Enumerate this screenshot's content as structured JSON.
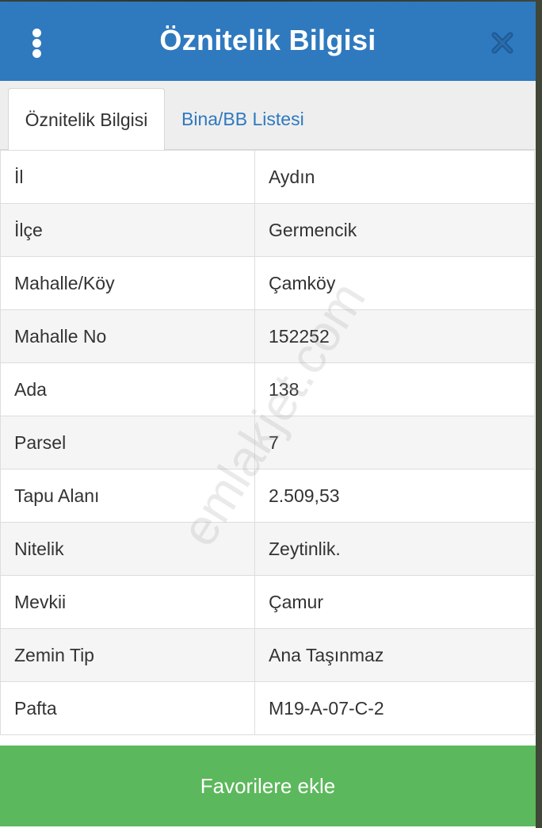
{
  "header": {
    "title": "Öznitelik Bilgisi",
    "menu_icon": "vertical-dots-icon",
    "close_icon": "close-icon",
    "background_color": "#2f79bf"
  },
  "tabs": [
    {
      "label": "Öznitelik Bilgisi",
      "active": true
    },
    {
      "label": "Bina/BB Listesi",
      "active": false
    }
  ],
  "attributes": [
    {
      "key": "İl",
      "value": "Aydın"
    },
    {
      "key": "İlçe",
      "value": "Germencik"
    },
    {
      "key": "Mahalle/Köy",
      "value": "Çamköy"
    },
    {
      "key": "Mahalle No",
      "value": "152252"
    },
    {
      "key": "Ada",
      "value": "138"
    },
    {
      "key": "Parsel",
      "value": "7"
    },
    {
      "key": "Tapu Alanı",
      "value": "2.509,53"
    },
    {
      "key": "Nitelik",
      "value": "Zeytinlik."
    },
    {
      "key": "Mevkii",
      "value": "Çamur"
    },
    {
      "key": "Zemin Tip",
      "value": "Ana Taşınmaz"
    },
    {
      "key": "Pafta",
      "value": "M19-A-07-C-2"
    }
  ],
  "footer": {
    "button_label": "Favorilere ekle",
    "button_color": "#5cb85c"
  },
  "watermark": "emlakjet.com"
}
